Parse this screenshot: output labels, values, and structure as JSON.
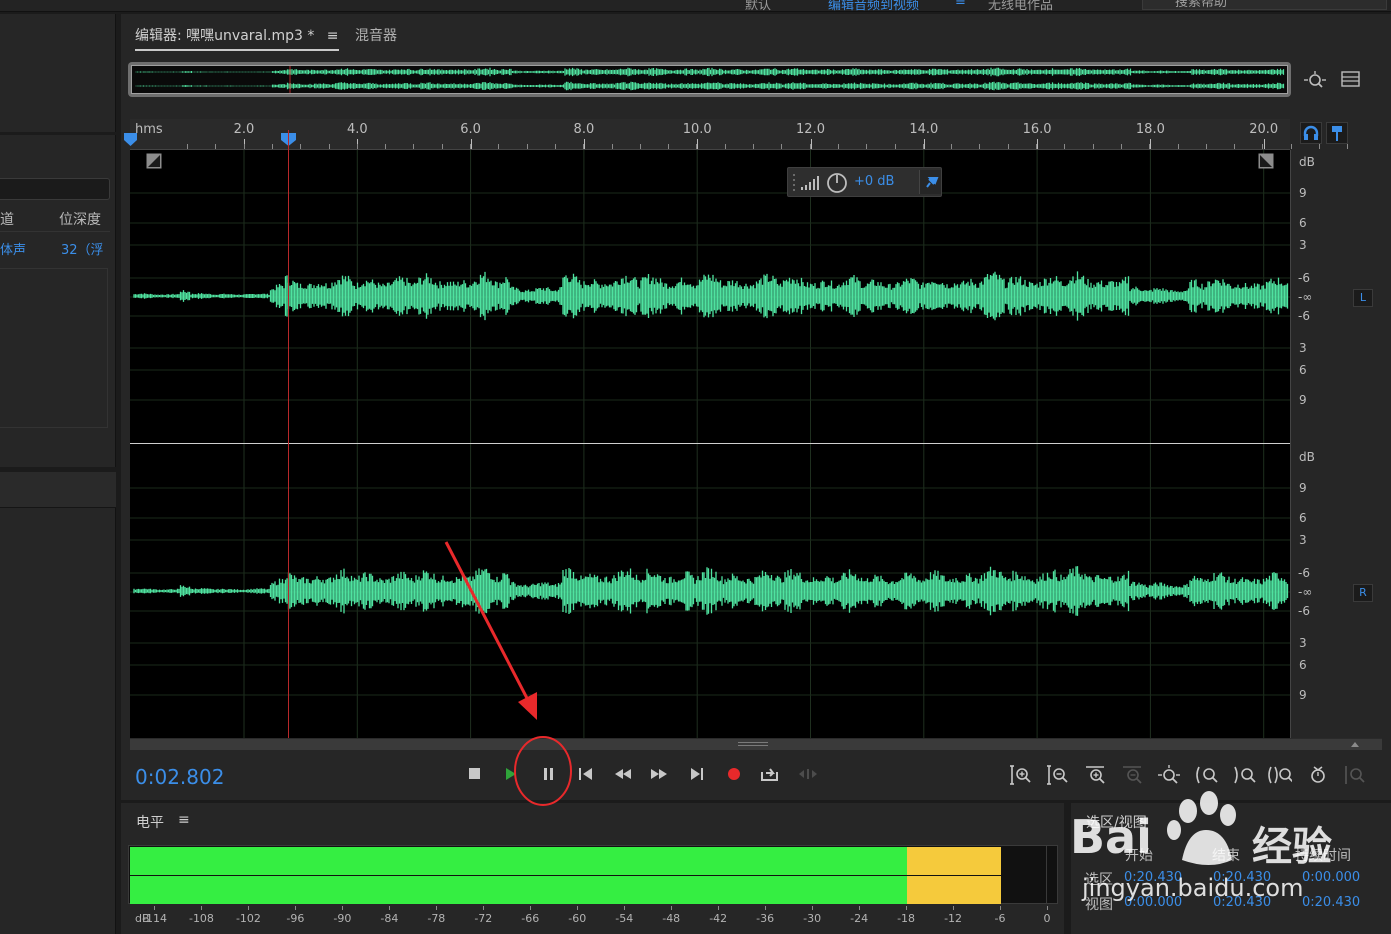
{
  "topbar": {
    "tabs": [
      "默认",
      "编辑音频到视频",
      "无线电作品"
    ],
    "help_search_placeholder": "搜索帮助"
  },
  "left_panel": {
    "header_cols": [
      "道",
      "位深度"
    ],
    "row": [
      "体声",
      "32（浮"
    ]
  },
  "editor": {
    "tab_editor": "编辑器: 嘿嘿unvaral.mp3 *",
    "tab_mixer": "混音器",
    "ruler_unit": "hms",
    "ruler_ticks": [
      "2.0",
      "4.0",
      "6.0",
      "8.0",
      "10.0",
      "12.0",
      "14.0",
      "16.0",
      "18.0",
      "20.0"
    ],
    "db_unit": "dB",
    "db_labels_top": [
      "9",
      "6",
      "3",
      "-6",
      "-∞",
      "-6",
      "3",
      "6",
      "9"
    ],
    "channel_left": "L",
    "channel_right": "R",
    "hud_gain": "+0 dB",
    "current_time": "0:02.802"
  },
  "levels": {
    "title": "电平",
    "menu_icon": "≡",
    "db_label": "dB",
    "scale": [
      "-114",
      "-108",
      "-102",
      "-96",
      "-90",
      "-84",
      "-78",
      "-72",
      "-66",
      "-60",
      "-54",
      "-48",
      "-42",
      "-36",
      "-30",
      "-24",
      "-18",
      "-12",
      "-6",
      "0"
    ],
    "green_level_db": -18,
    "yellow_level_db": -6,
    "colors": {
      "green": "#35ee42",
      "yellow": "#f5ca3c"
    }
  },
  "selection_view": {
    "title": "选区/视图",
    "cols": [
      "开始",
      "结束",
      "持续时间"
    ],
    "rows": [
      {
        "label": "选区",
        "start": "0:20.430",
        "end": "0:20.430",
        "duration": "0:00.000"
      },
      {
        "label": "视图",
        "start": "0:00.000",
        "end": "0:20.430",
        "duration": "0:20.430"
      }
    ]
  },
  "watermark": {
    "brand": "Bai",
    "brand_cn": "经验",
    "url": "jingyan.baidu.com"
  },
  "colors": {
    "accent": "#3b8ee8",
    "waveform": "#4fe3a0",
    "playhead": "#b8282a",
    "annotation": "#e8292b"
  }
}
